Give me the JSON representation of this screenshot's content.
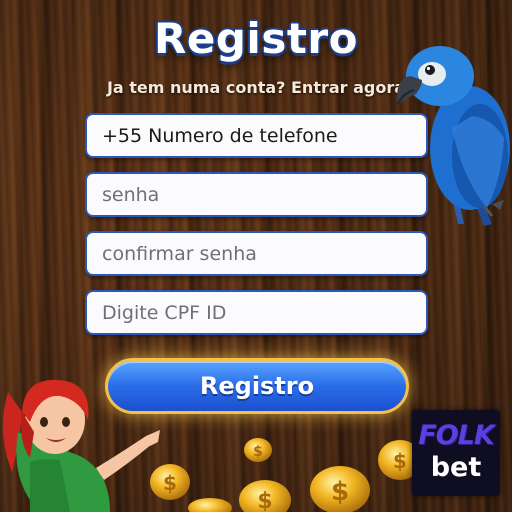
{
  "header": {
    "title": "Registro",
    "subtitle": "Ja tem numa conta? Entrar agora"
  },
  "form": {
    "phone_placeholder": "+55 Numero de telefone",
    "password_placeholder": "senha",
    "confirm_password_placeholder": "confirmar senha",
    "cpf_placeholder": "Digite CPF ID",
    "submit_label": "Registro"
  },
  "logo": {
    "line1": "FOLK",
    "line2": "bet"
  },
  "colors": {
    "accent_blue": "#2a6de8",
    "gold": "#f3c14a",
    "wood": "#57301a"
  },
  "icons": [
    "parrot-illustration",
    "woman-illustration",
    "gold-coins-illustration"
  ]
}
